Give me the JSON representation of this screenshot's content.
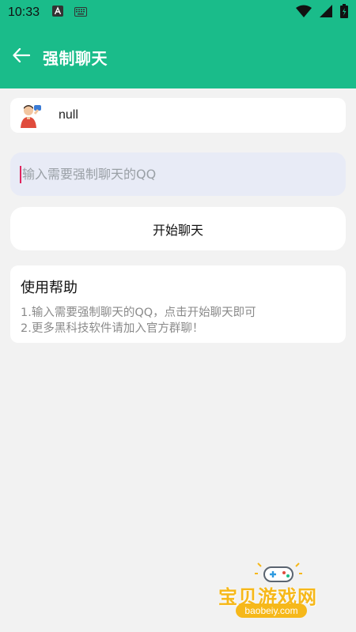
{
  "status_bar": {
    "time": "10:33",
    "left_icons": [
      "android-a-icon",
      "keyboard-icon"
    ],
    "right_icons": [
      "wifi-icon",
      "signal-icon",
      "battery-icon"
    ]
  },
  "app_bar": {
    "back_icon": "arrow-left-icon",
    "title": "强制聊天"
  },
  "user_card": {
    "avatar_icon": "avatar-icon",
    "name": "null"
  },
  "qq_input": {
    "value": "",
    "placeholder": "输入需要强制聊天的QQ"
  },
  "start_button": {
    "label": "开始聊天"
  },
  "help": {
    "title": "使用帮助",
    "lines": [
      "1.输入需要强制聊天的QQ，点击开始聊天即可",
      "2.更多黑科技软件请加入官方群聊！"
    ]
  },
  "watermark": {
    "text": "宝贝游戏网",
    "url": "baobeiy.com"
  },
  "colors": {
    "primary": "#1abc8a",
    "background": "#f2f2f2",
    "input_bg": "#e8ebf6",
    "caret": "#e0245e",
    "watermark": "#f6b81a"
  }
}
